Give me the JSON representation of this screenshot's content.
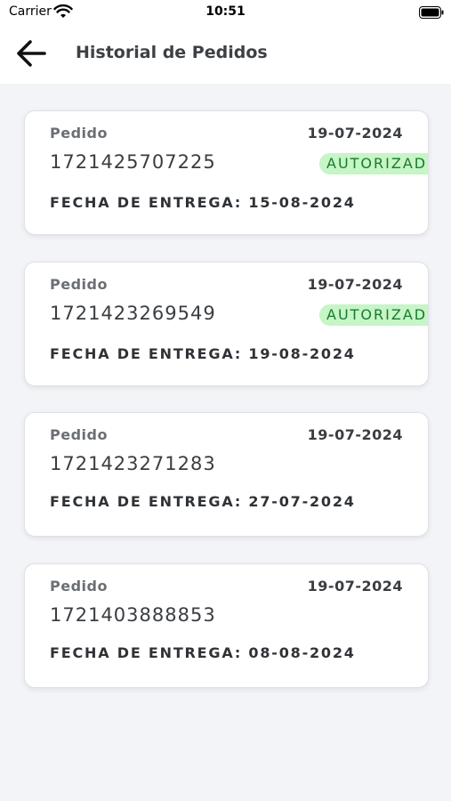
{
  "status_bar": {
    "carrier": "Carrier",
    "time": "10:51",
    "icons": [
      "wifi-icon",
      "battery-icon"
    ]
  },
  "header": {
    "title": "Historial de Pedidos",
    "back_icon": "arrow-left-icon"
  },
  "orders": [
    {
      "label": "Pedido",
      "date": "19-07-2024",
      "number": "1721425707225",
      "status": "AUTORIZADO",
      "delivery": "FECHA DE ENTREGA: 15-08-2024"
    },
    {
      "label": "Pedido",
      "date": "19-07-2024",
      "number": "1721423269549",
      "status": "AUTORIZADO",
      "delivery": "FECHA DE ENTREGA: 19-08-2024"
    },
    {
      "label": "Pedido",
      "date": "19-07-2024",
      "number": "1721423271283",
      "status": "",
      "delivery": "FECHA DE ENTREGA: 27-07-2024"
    },
    {
      "label": "Pedido",
      "date": "19-07-2024",
      "number": "1721403888853",
      "status": "",
      "delivery": "FECHA DE ENTREGA: 08-08-2024"
    }
  ],
  "colors": {
    "background": "#f3f4f7",
    "card": "#ffffff",
    "badge_background": "#c6f5c6",
    "badge_text": "#1b7a2e"
  }
}
